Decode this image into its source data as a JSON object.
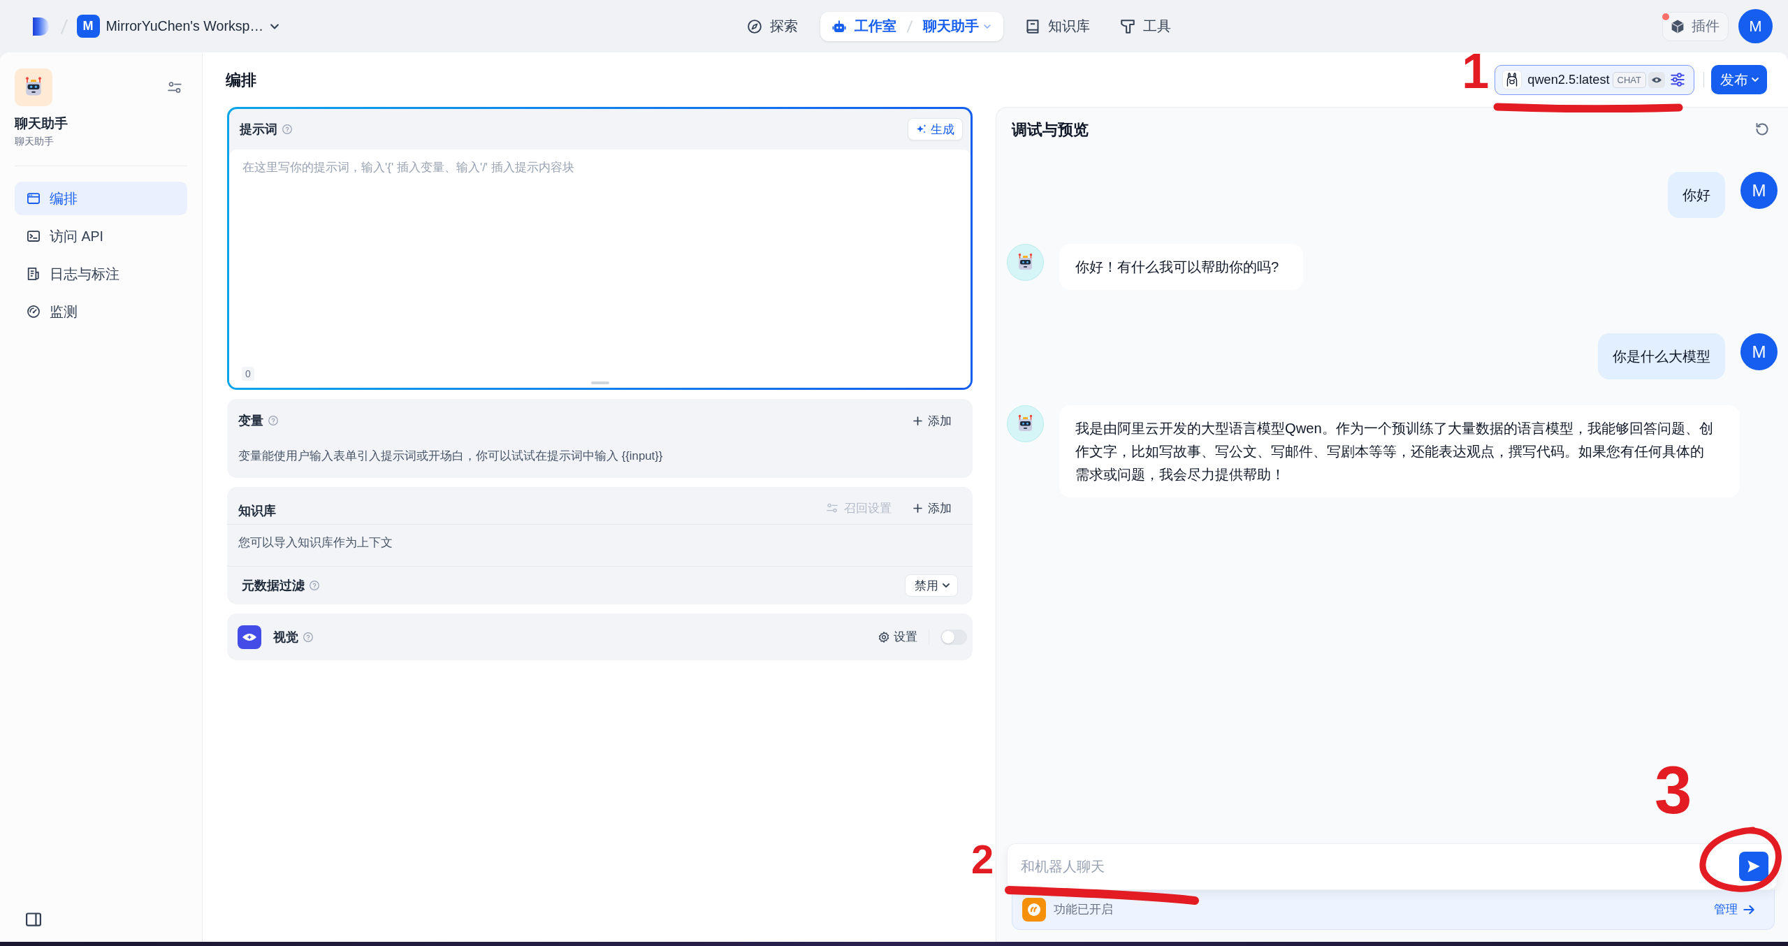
{
  "top_bar": {
    "workspace": {
      "initial": "M",
      "name": "MirrorYuChen's Worksp…"
    },
    "nav": [
      {
        "kind": "explore",
        "label": "探索",
        "selected": false
      },
      {
        "kind": "studio",
        "label": "工作室",
        "selected": true,
        "current_app": "聊天助手"
      },
      {
        "kind": "knowledge",
        "label": "知识库",
        "selected": false
      },
      {
        "kind": "tools",
        "label": "工具",
        "selected": false
      }
    ],
    "plugins": {
      "label": "插件",
      "notification": true
    },
    "user_avatar": "M"
  },
  "sidebar": {
    "app_name": "聊天助手",
    "app_type": "聊天助手",
    "items": [
      {
        "kind": "layout",
        "label": "编排",
        "selected": true
      },
      {
        "kind": "terminal",
        "label": "访问 API",
        "selected": false
      },
      {
        "kind": "log",
        "label": "日志与标注",
        "selected": false
      },
      {
        "kind": "monitor",
        "label": "监测",
        "selected": false
      }
    ]
  },
  "model_bar": {
    "model_selector": {
      "model": "qwen2.5:latest",
      "mode": "CHAT",
      "annotation": {
        "number": "1",
        "kind": "underline"
      }
    },
    "publish_button": "发布"
  },
  "orchestrate": {
    "title": "编排",
    "prompt": {
      "label": "提示词",
      "generate_button": "生成",
      "placeholder": "在这里写你的提示词，输入'{' 插入变量、输入'/' 插入提示内容块",
      "char_count": "0"
    },
    "sections": [
      {
        "kind": "variables",
        "title": "变量",
        "add_button": "添加",
        "description": "变量能使用户输入表单引入提示词或开场白，你可以试试在提示词中输入 {{input}}"
      },
      {
        "kind": "knowledge",
        "title": "知识库",
        "retrieval_settings": {
          "label": "召回设置",
          "disabled": true
        },
        "add_button": "添加",
        "description": "您可以导入知识库作为上下文",
        "metadata_filter": {
          "label": "元数据过滤",
          "value": "禁用"
        }
      },
      {
        "kind": "vision",
        "title": "视觉",
        "settings_button": "设置",
        "on": false
      }
    ]
  },
  "debug_panel": {
    "title": "调试与预览",
    "messages": [
      {
        "kind": "user",
        "avatar": "M",
        "text": "你好"
      },
      {
        "kind": "assistant",
        "text": "你好！有什么我可以帮助你的吗?"
      },
      {
        "kind": "user",
        "avatar": "M",
        "text": "你是什么大模型"
      },
      {
        "kind": "assistant",
        "text": "我是由阿里云开发的大型语言模型Qwen。作为一个预训练了大量数据的语言模型，我能够回答问题、创作文字，比如写故事、写公文、写邮件、写剧本等等，还能表达观点，撰写代码。如果您有任何具体的需求或问题，我会尽力提供帮助！"
      }
    ],
    "chat_input": {
      "placeholder": "和机器人聊天",
      "annotation": {
        "number": "2",
        "kind": "underline"
      }
    },
    "send_button": {
      "annotation": {
        "number": "3",
        "kind": "circle"
      }
    },
    "features": {
      "status": "功能已开启",
      "manage_link": "管理"
    }
  }
}
